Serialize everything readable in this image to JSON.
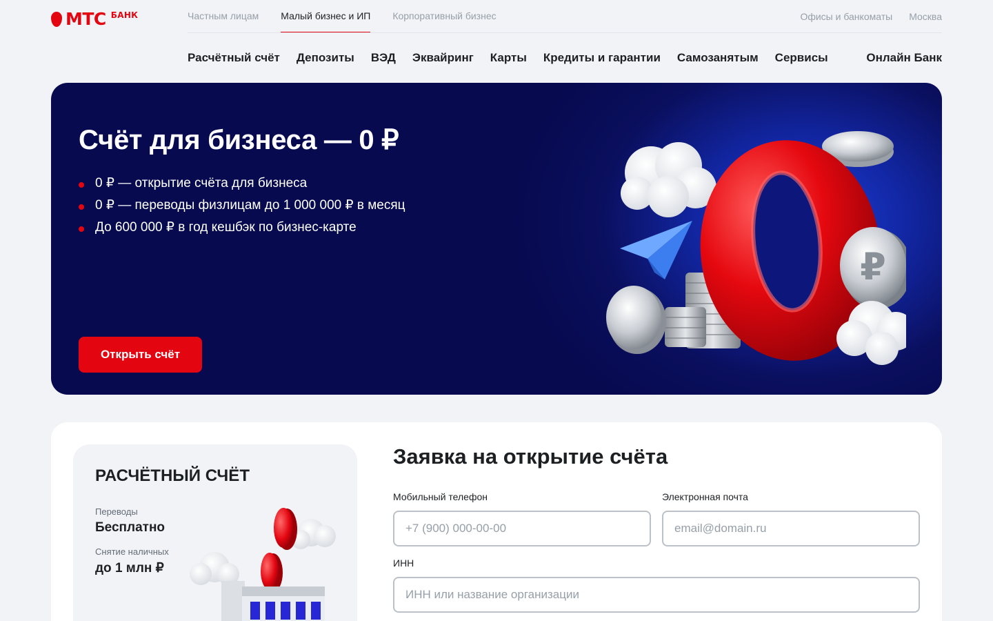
{
  "logo": {
    "brand": "МТС",
    "suffix": "БАНК"
  },
  "top_nav": {
    "items": [
      "Частным лицам",
      "Малый бизнес и ИП",
      "Корпоративный бизнес"
    ],
    "active_index": 1,
    "offices": "Офисы и банкоматы",
    "city": "Москва"
  },
  "main_nav": {
    "items": [
      "Расчётный счёт",
      "Депозиты",
      "ВЭД",
      "Эквайринг",
      "Карты",
      "Кредиты и гарантии",
      "Самозанятым",
      "Сервисы"
    ],
    "online_bank": "Онлайн Банк"
  },
  "hero": {
    "title": "Счёт для бизнеса — 0 ₽",
    "bullets": [
      "0 ₽ — открытие счёта для бизнеса",
      "0 ₽ — переводы физлицам до 1 000 000 ₽ в месяц",
      "До 600 000 ₽ в год кешбэк по бизнес-карте"
    ],
    "button": "Открыть счёт",
    "art_digit": "0",
    "art_coin_symbol": "₽"
  },
  "promo": {
    "title": "РАСЧЁТНЫЙ СЧЁТ",
    "transfers_label": "Переводы",
    "transfers_value": "Бесплатно",
    "cash_label": "Снятие наличных",
    "cash_value": "до 1 млн ₽"
  },
  "form": {
    "title": "Заявка на открытие счёта",
    "phone_label": "Мобильный телефон",
    "phone_placeholder": "+7 (900) 000-00-00",
    "email_label": "Электронная почта",
    "email_placeholder": "email@domain.ru",
    "inn_label": "ИНН",
    "inn_placeholder": "ИНН или название организации"
  },
  "colors": {
    "brand_red": "#e30611",
    "hero_bg": "#0a0f5e",
    "page_bg": "#f2f3f7"
  }
}
